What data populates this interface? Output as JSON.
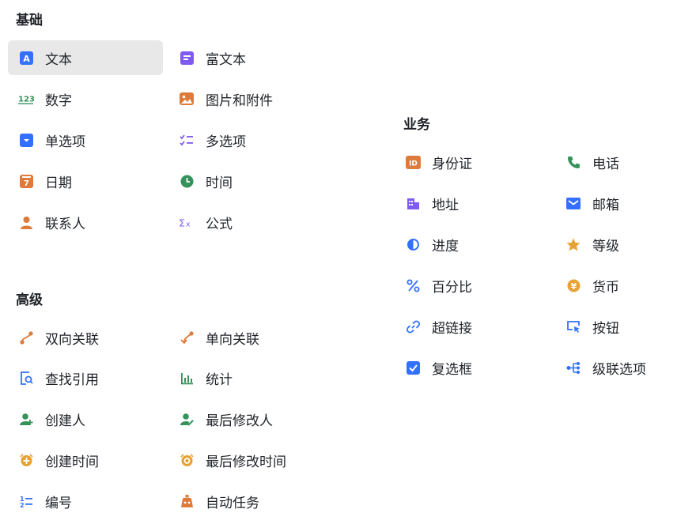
{
  "sections": {
    "basic": {
      "title": "基础",
      "items": [
        {
          "label": "文本",
          "icon": "text-icon"
        },
        {
          "label": "富文本",
          "icon": "rich-text-icon"
        },
        {
          "label": "数字",
          "icon": "number-icon"
        },
        {
          "label": "图片和附件",
          "icon": "image-attachment-icon"
        },
        {
          "label": "单选项",
          "icon": "single-select-icon"
        },
        {
          "label": "多选项",
          "icon": "multi-select-icon"
        },
        {
          "label": "日期",
          "icon": "date-icon"
        },
        {
          "label": "时间",
          "icon": "time-icon"
        },
        {
          "label": "联系人",
          "icon": "contact-icon"
        },
        {
          "label": "公式",
          "icon": "formula-icon"
        }
      ]
    },
    "advanced": {
      "title": "高级",
      "items": [
        {
          "label": "双向关联",
          "icon": "two-way-link-icon"
        },
        {
          "label": "单向关联",
          "icon": "one-way-link-icon"
        },
        {
          "label": "查找引用",
          "icon": "lookup-icon"
        },
        {
          "label": "统计",
          "icon": "statistics-icon"
        },
        {
          "label": "创建人",
          "icon": "creator-icon"
        },
        {
          "label": "最后修改人",
          "icon": "last-modifier-icon"
        },
        {
          "label": "创建时间",
          "icon": "created-time-icon"
        },
        {
          "label": "最后修改时间",
          "icon": "modified-time-icon"
        },
        {
          "label": "编号",
          "icon": "serial-number-icon"
        },
        {
          "label": "自动任务",
          "icon": "auto-task-icon"
        }
      ]
    },
    "business": {
      "title": "业务",
      "items": [
        {
          "label": "身份证",
          "icon": "id-card-icon"
        },
        {
          "label": "电话",
          "icon": "phone-icon"
        },
        {
          "label": "地址",
          "icon": "address-icon"
        },
        {
          "label": "邮箱",
          "icon": "email-icon"
        },
        {
          "label": "进度",
          "icon": "progress-icon"
        },
        {
          "label": "等级",
          "icon": "rating-icon"
        },
        {
          "label": "百分比",
          "icon": "percent-icon"
        },
        {
          "label": "货币",
          "icon": "currency-icon"
        },
        {
          "label": "超链接",
          "icon": "hyperlink-icon"
        },
        {
          "label": "按钮",
          "icon": "button-icon"
        },
        {
          "label": "复选框",
          "icon": "checkbox-icon"
        },
        {
          "label": "级联选项",
          "icon": "cascade-select-icon"
        }
      ]
    }
  },
  "selected": "文本",
  "colors": {
    "blue": "#3370ff",
    "purple": "#7f5af0",
    "orange": "#de7a3a",
    "green": "#35925a",
    "gold": "#e6a235",
    "selected_bg": "#e8e8e8"
  }
}
